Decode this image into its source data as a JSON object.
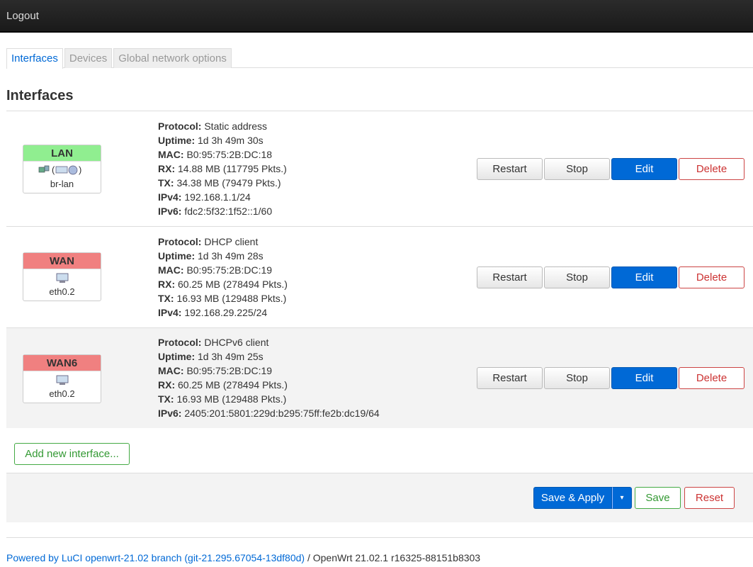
{
  "topbar": {
    "logout": "Logout"
  },
  "tabs": [
    {
      "label": "Interfaces",
      "active": true
    },
    {
      "label": "Devices",
      "active": false
    },
    {
      "label": "Global network options",
      "active": false
    }
  ],
  "page_title": "Interfaces",
  "field_labels": {
    "protocol": "Protocol:",
    "uptime": "Uptime:",
    "mac": "MAC:",
    "rx": "RX:",
    "tx": "TX:",
    "ipv4": "IPv4:",
    "ipv6": "IPv6:"
  },
  "row_buttons": {
    "restart": "Restart",
    "stop": "Stop",
    "edit": "Edit",
    "delete": "Delete"
  },
  "interfaces": [
    {
      "name": "LAN",
      "status_color": "#90ee90",
      "icons": "bridge-icons (☷☷)",
      "device": "br-lan",
      "protocol": "Static address",
      "uptime": "1d 3h 49m 30s",
      "mac": "B0:95:75:2B:DC:18",
      "rx": "14.88 MB (117795 Pkts.)",
      "tx": "34.38 MB (79479 Pkts.)",
      "ipv4": "192.168.1.1/24",
      "ipv6": "fdc2:5f32:1f52::1/60"
    },
    {
      "name": "WAN",
      "status_color": "#f08080",
      "icons": "ethernet-icon",
      "device": "eth0.2",
      "protocol": "DHCP client",
      "uptime": "1d 3h 49m 28s",
      "mac": "B0:95:75:2B:DC:19",
      "rx": "60.25 MB (278494 Pkts.)",
      "tx": "16.93 MB (129488 Pkts.)",
      "ipv4": "192.168.29.225/24"
    },
    {
      "name": "WAN6",
      "status_color": "#f08080",
      "icons": "ethernet-icon",
      "device": "eth0.2",
      "protocol": "DHCPv6 client",
      "uptime": "1d 3h 49m 25s",
      "mac": "B0:95:75:2B:DC:19",
      "rx": "60.25 MB (278494 Pkts.)",
      "tx": "16.93 MB (129488 Pkts.)",
      "ipv6": "2405:201:5801:229d:b295:75ff:fe2b:dc19/64"
    }
  ],
  "add_interface": "Add new interface...",
  "footer_actions": {
    "save_apply": "Save & Apply",
    "dropdown": "▾",
    "save": "Save",
    "reset": "Reset"
  },
  "footer": {
    "powered_link": "Powered by LuCI openwrt-21.02 branch (git-21.295.67054-13df80d)",
    "version": " / OpenWrt 21.02.1 r16325-88151b8303"
  },
  "colors": {
    "accent": "#0069d6",
    "danger": "#cc3333",
    "success": "#339933"
  }
}
